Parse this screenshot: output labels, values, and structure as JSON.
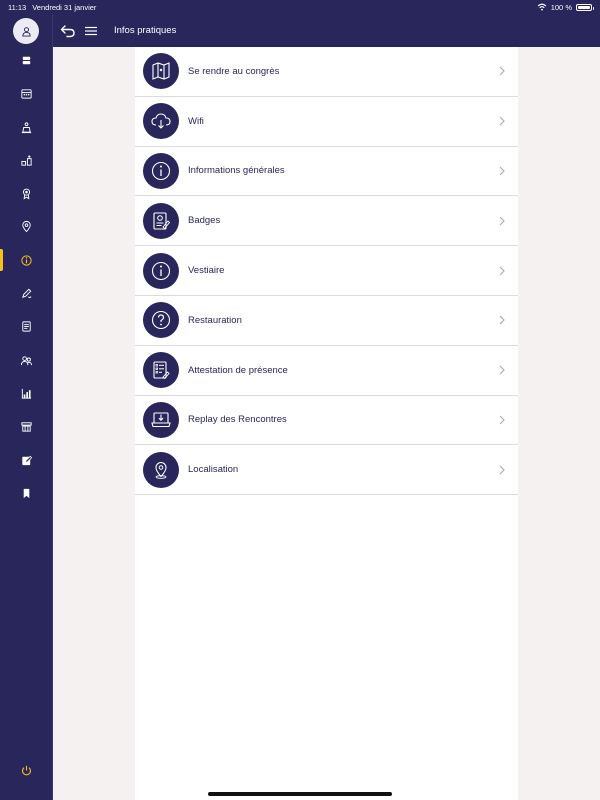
{
  "status": {
    "time": "11:13",
    "date": "Vendredi 31 janvier",
    "battery": "100 %"
  },
  "header": {
    "title": "Infos pratiques"
  },
  "sidebar": {
    "items": [
      {
        "icon": "stack-icon"
      },
      {
        "icon": "calendar-icon"
      },
      {
        "icon": "podium-icon"
      },
      {
        "icon": "exhibitors-icon"
      },
      {
        "icon": "award-icon"
      },
      {
        "icon": "location-pin-icon"
      },
      {
        "icon": "info-icon",
        "active": true
      },
      {
        "icon": "pen-icon"
      },
      {
        "icon": "document-icon"
      },
      {
        "icon": "people-icon"
      },
      {
        "icon": "chart-icon"
      },
      {
        "icon": "stand-icon"
      },
      {
        "icon": "edit-icon"
      },
      {
        "icon": "bookmark-icon"
      }
    ],
    "power_icon": "power-icon"
  },
  "list": {
    "items": [
      {
        "label": "Se rendre au congrès",
        "icon": "map-icon"
      },
      {
        "label": "Wifi",
        "icon": "cloud-download-icon"
      },
      {
        "label": "Informations générales",
        "icon": "info-icon"
      },
      {
        "label": "Badges",
        "icon": "badge-icon"
      },
      {
        "label": "Vestiaire",
        "icon": "info-icon"
      },
      {
        "label": "Restauration",
        "icon": "question-icon"
      },
      {
        "label": "Attestation de présence",
        "icon": "certificate-icon"
      },
      {
        "label": "Replay des Rencontres",
        "icon": "laptop-download-icon"
      },
      {
        "label": "Localisation",
        "icon": "location-pin-icon"
      }
    ]
  },
  "colors": {
    "primary": "#28265a",
    "accent": "#f3c21b",
    "background": "#f4f1f0",
    "panel": "#ffffff"
  }
}
